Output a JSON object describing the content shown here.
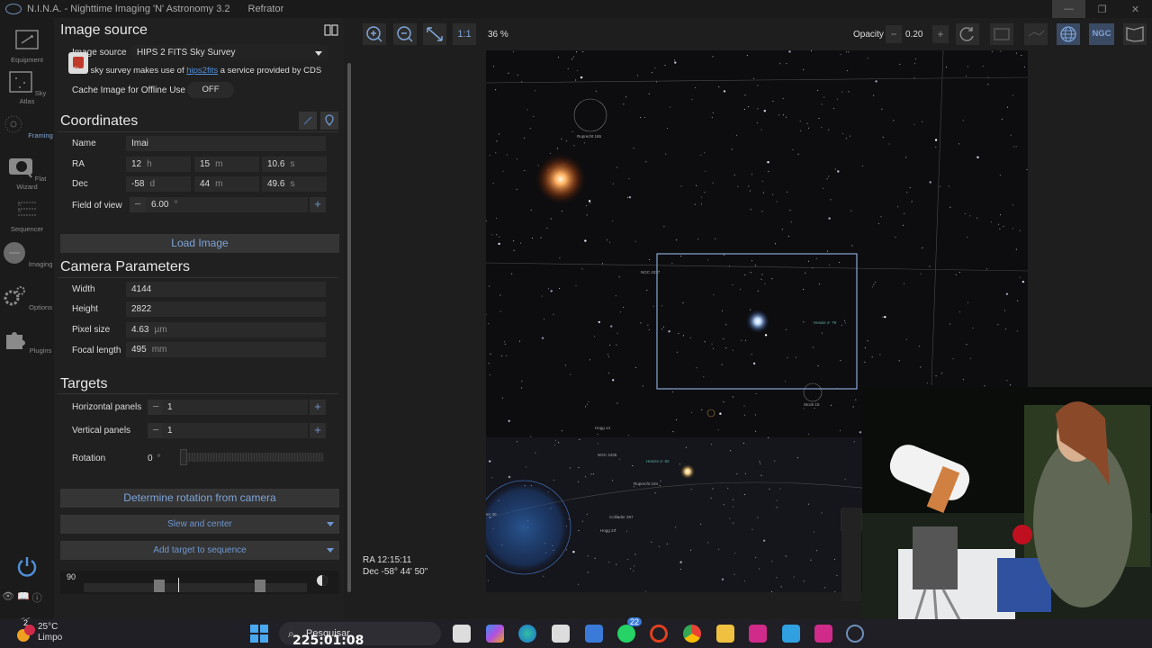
{
  "window": {
    "app_title": "N.I.N.A. - Nighttime Imaging 'N' Astronomy 3.2",
    "profile": "Refrator"
  },
  "nav": {
    "items": [
      {
        "label": "Equipment",
        "icon": "equipment-icon"
      },
      {
        "label": "Sky Atlas",
        "icon": "sky-atlas-icon"
      },
      {
        "label": "Framing",
        "icon": "framing-icon",
        "active": true
      },
      {
        "label": "Flat Wizard",
        "icon": "flat-wizard-icon"
      },
      {
        "label": "Sequencer",
        "icon": "sequencer-icon"
      },
      {
        "label": "Imaging",
        "icon": "imaging-icon"
      },
      {
        "label": "Options",
        "icon": "options-icon"
      },
      {
        "label": "Plugins",
        "icon": "plugins-icon"
      }
    ],
    "collapse_label": "<<"
  },
  "image_source": {
    "title": "Image source",
    "label": "Image source",
    "value": "HIPS 2 FITS Sky Survey",
    "notice_pre": "This sky survey makes use of ",
    "notice_link": "hips2fits",
    "notice_post": " a service provided by CDS",
    "cache_label": "Cache Image for Offline Use",
    "cache_state": "OFF"
  },
  "coordinates": {
    "title": "Coordinates",
    "name_label": "Name",
    "name_value": "Imai",
    "ra_label": "RA",
    "ra_h": "12",
    "ra_h_unit": "h",
    "ra_m": "15",
    "ra_m_unit": "m",
    "ra_s": "10.6",
    "ra_s_unit": "s",
    "dec_label": "Dec",
    "dec_d": "-58",
    "dec_d_unit": "d",
    "dec_m": "44",
    "dec_m_unit": "m",
    "dec_s": "49.6",
    "dec_s_unit": "s",
    "fov_label": "Field of view",
    "fov_value": "6.00",
    "fov_unit": "°",
    "load_button": "Load Image"
  },
  "camera": {
    "title": "Camera Parameters",
    "width_label": "Width",
    "width_value": "4144",
    "height_label": "Height",
    "height_value": "2822",
    "pixel_label": "Pixel size",
    "pixel_value": "4.63",
    "pixel_unit": "µm",
    "focal_label": "Focal length",
    "focal_value": "495",
    "focal_unit": "mm"
  },
  "targets": {
    "title": "Targets",
    "hpanels_label": "Horizontal panels",
    "hpanels_value": "1",
    "vpanels_label": "Vertical panels",
    "vpanels_value": "1",
    "rotation_label": "Rotation",
    "rotation_value": "0",
    "rotation_unit": "°",
    "rotation_button": "Determine rotation from camera",
    "slew_button": "Slew and center",
    "add_button": "Add target to sequence"
  },
  "altitude": {
    "value_label": "90"
  },
  "toolbar": {
    "one_to_one": "1:1",
    "zoom": "36 %",
    "opacity_label": "Opacity",
    "opacity_value": "0.20",
    "ngc_label": "NGC"
  },
  "sky": {
    "labels": [
      "Ruprecht 165",
      "NGC 4337",
      "Hessie 2- 79",
      "Stock 15",
      "Hogg 14",
      "NGC 4435",
      "Henize 2- 82",
      "Ruprecht 104",
      "Collinder 257",
      "Hogg 23",
      "ter 30"
    ],
    "ra_readout": "RA  12:15:11",
    "dec_readout": "Dec  -58° 44' 50\""
  },
  "taskbar": {
    "temperature": "25°C",
    "weather": "Limpo",
    "weather_badge": "2",
    "search_placeholder": "Pesquisar",
    "timer": "225:01:08",
    "whatsapp_badge": "22"
  }
}
